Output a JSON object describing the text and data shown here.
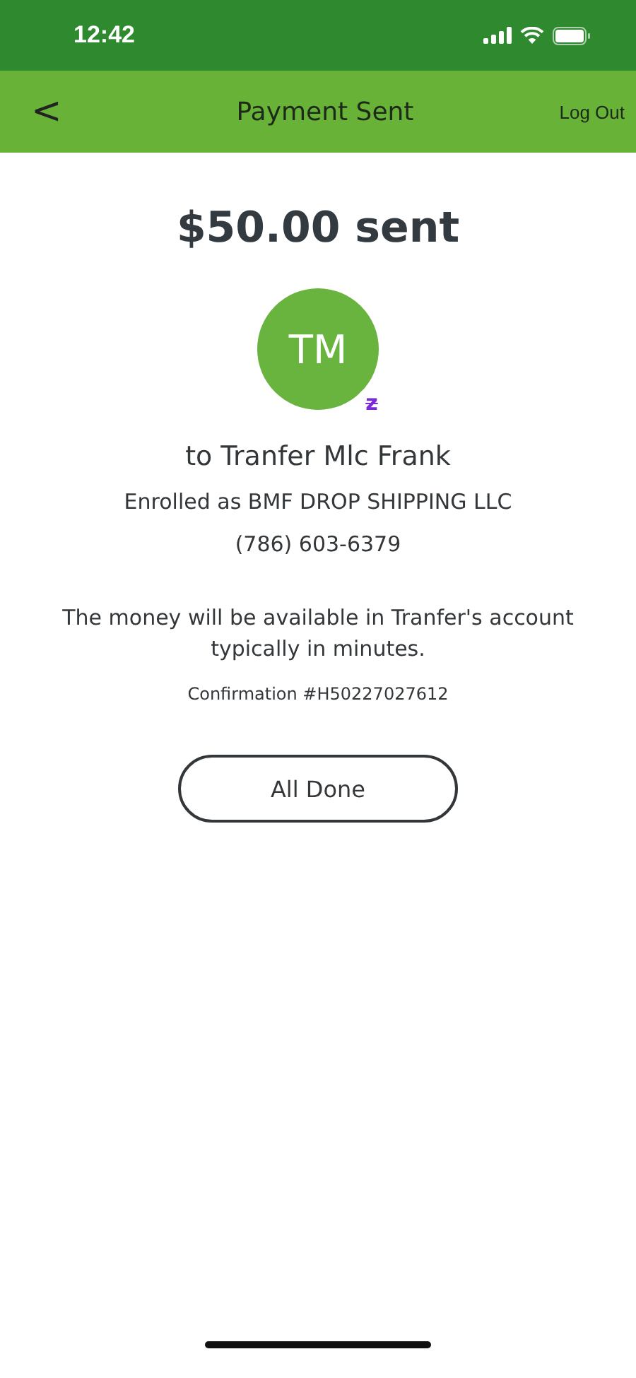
{
  "status_bar": {
    "time": "12:42"
  },
  "nav": {
    "back": "<",
    "title": "Payment Sent",
    "action": "Log Out"
  },
  "payment": {
    "amount": "$50.00 sent",
    "avatar_initials": "TM",
    "badge": "z",
    "recipient": "to Tranfer Mlc Frank",
    "enrolled": "Enrolled as BMF DROP SHIPPING LLC",
    "phone": "(786) 603-6379",
    "message": "The money will be available in Tranfer's account typically in minutes.",
    "confirmation": "Confirmation #H50227027612"
  },
  "buttons": [
    "All Done"
  ]
}
